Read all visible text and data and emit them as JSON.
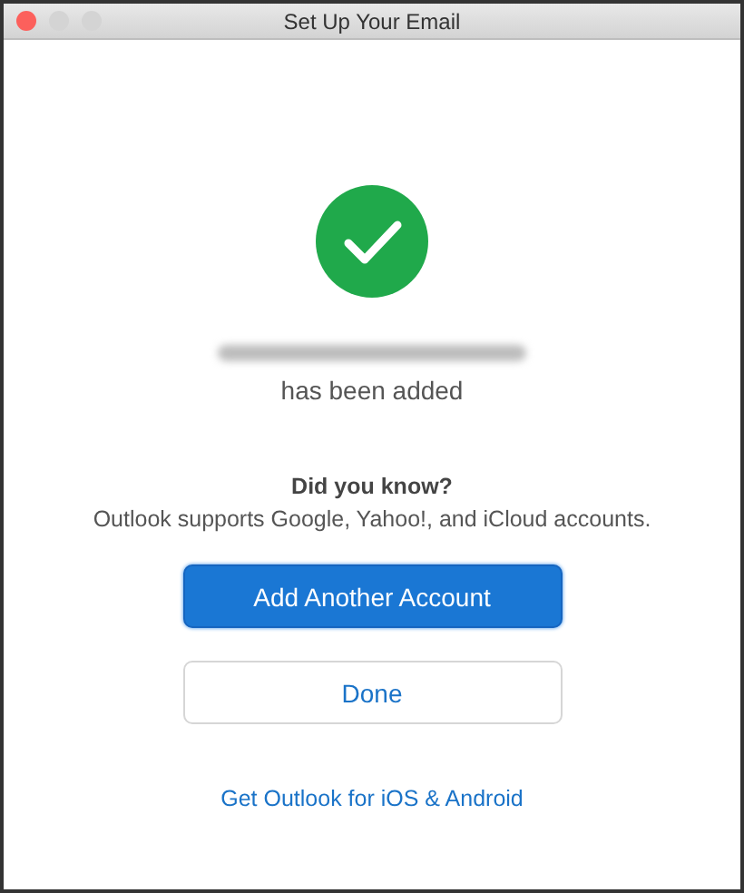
{
  "window": {
    "title": "Set Up Your Email",
    "controls": [
      {
        "kind": "close",
        "disabled": false
      },
      {
        "kind": "minimize",
        "disabled": true
      },
      {
        "kind": "zoom",
        "disabled": true
      }
    ]
  },
  "status": {
    "message": "has been added"
  },
  "tip": {
    "heading": "Did you know?",
    "text": "Outlook supports Google, Yahoo!, and iCloud accounts."
  },
  "buttons": [
    {
      "label": "Add Another Account",
      "kind": "primary"
    },
    {
      "label": "Done",
      "kind": "secondary"
    }
  ],
  "link": "Get Outlook for iOS & Android"
}
